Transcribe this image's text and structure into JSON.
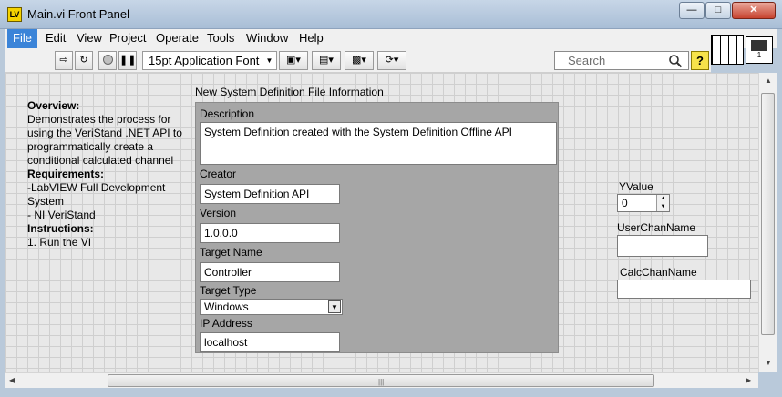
{
  "window": {
    "title": "Main.vi Front Panel",
    "app_icon_text": "LV"
  },
  "menu": [
    "File",
    "Edit",
    "View",
    "Project",
    "Operate",
    "Tools",
    "Window",
    "Help"
  ],
  "toolbar": {
    "font": "15pt Application Font",
    "search_placeholder": "Search",
    "help_label": "?"
  },
  "vi_icon_label": "1",
  "notes": {
    "overview_heading": "Overview:",
    "overview_text": "Demonstrates the process for using the VeriStand .NET API to programmatically create a conditional calculated channel",
    "requirements_heading": "Requirements:",
    "req1": "-LabVIEW Full Development System",
    "req2": "- NI VeriStand",
    "instructions_heading": "Instructions:",
    "instr1": "1. Run the VI"
  },
  "cluster": {
    "title": "New System Definition File Information",
    "description_label": "Description",
    "description_value": "System Definition created with the System Definition Offline API",
    "creator_label": "Creator",
    "creator_value": "System Definition API",
    "version_label": "Version",
    "version_value": "1.0.0.0",
    "target_name_label": "Target Name",
    "target_name_value": "Controller",
    "target_type_label": "Target Type",
    "target_type_value": "Windows",
    "ip_label": "IP Address",
    "ip_value": "localhost"
  },
  "controls": {
    "yvalue_label": "YValue",
    "yvalue": "0",
    "user_chan_label": "UserChanName",
    "user_chan_value": "",
    "calc_chan_label": "CalcChanName",
    "calc_chan_value": ""
  }
}
